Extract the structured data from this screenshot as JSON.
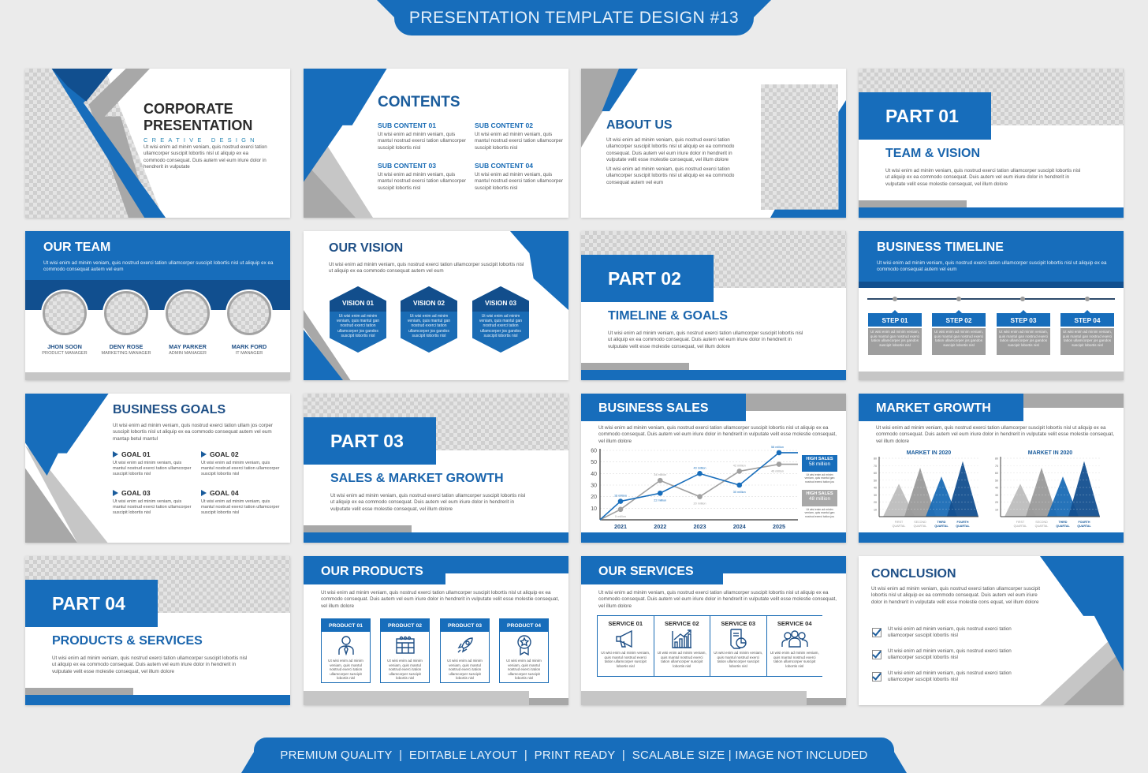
{
  "header": {
    "title": "PRESENTATION TEMPLATE DESIGN #13"
  },
  "footer": {
    "tagline": "PREMIUM QUALITY  |  EDITABLE LAYOUT  |  PRINT READY  |  SCALABLE SIZE | IMAGE NOT INCLUDED"
  },
  "theme": {
    "primary": "#176dbb",
    "dark_blue": "#114f8f",
    "gray": "#a8a8a8",
    "text": "#333333"
  },
  "slides": {
    "cover": {
      "title1": "CORPORATE",
      "title2": "PRESENTATION",
      "tagline": "CREATIVE DESIGN",
      "body": "Ut wisi enim ad minim veniam, quis nostrud exerci tation ullamcorper suscipit lobortis nisl ut aliquip ex ea commodo consequat. Duis autem vel eum iriure dolor in hendrerit in vulputate"
    },
    "contents": {
      "title": "CONTENTS",
      "items": [
        {
          "title": "SUB CONTENT 01",
          "body": "Ut wisi enim ad minim veniam, quis mantul nostrud exerci tation ullamcorper suscipit lobortis nisl"
        },
        {
          "title": "SUB CONTENT 02",
          "body": "Ut wisi enim ad minim veniam, quis mantul nostrud exerci tation ullamcorper suscipit lobortis nisl"
        },
        {
          "title": "SUB CONTENT 03",
          "body": "Ut wisi enim ad minim veniam, quis mantul nostrud exerci tation ullamcorper suscipit lobortis nisl"
        },
        {
          "title": "SUB CONTENT 04",
          "body": "Ut wisi enim ad minim veniam, quis mantul nostrud exerci tation ullamcorper suscipit lobortis nisl"
        }
      ]
    },
    "about": {
      "title": "ABOUT US",
      "body1": "Ut wisi enim ad minim veniam, quis nostrud exerci tation ullamcorper suscipit lobortis nisl ut aliquip ex ea commodo consequat. Duis autem vel eum iriure dolor in hendrerit in vulputate velit esse molestie consequat, vel illum dolore",
      "body2": "Ut wisi enim ad minim veniam, quis nostrud exerci tation ullamcorper suscipit lobortis nisl ut aliquip ex ea commodo consequat autem vel eum"
    },
    "part1": {
      "label": "PART 01",
      "subtitle": "TEAM & VISION",
      "body": "Ut wisi enim ad minim veniam, quis nostrud exerci tation ullamcorper suscipit lobortis nisl ut aliquip ex ea commodo consequat. Duis autem vel eum iriure dolor in hendrerit in vulputate velit esse molestie consequat, vel illum dolore"
    },
    "team": {
      "title": "OUR TEAM",
      "body": "Ut wisi enim ad minim veniam, quis nostrud exerci tation ullamcorper suscipit lobortis nisl ut aliquip ex ea commodo consequat autem vel eum",
      "members": [
        {
          "name": "JHON SOON",
          "role": "PRODUCT MANAGER"
        },
        {
          "name": "DENY ROSE",
          "role": "MARKETING MANAGER"
        },
        {
          "name": "MAY PARKER",
          "role": "ADMIN MANAGER"
        },
        {
          "name": "MARK FORD",
          "role": "IT MANAGER"
        }
      ]
    },
    "vision": {
      "title": "OUR VISION",
      "body": "Ut wisi enim ad minim veniam, quis nostrud exerci tation ullamcorper suscipit lobortis nisl ut aliquip ex ea commodo consequat autem vel eum",
      "items": [
        {
          "title": "VISION 01",
          "body": "Ut wisi enim ad minim veniam, quis mantul gan nostrud exerci tation ullamcorper jos gandos suscipit lobortis nisl"
        },
        {
          "title": "VISION 02",
          "body": "Ut wisi enim ad minim veniam, quis mantul gan nostrud exerci tation ullamcorper jos gandos suscipit lobortis nisl"
        },
        {
          "title": "VISION 03",
          "body": "Ut wisi enim ad minim veniam, quis mantul gan nostrud exerci tation ullamcorper jos gandos suscipit lobortis nisl"
        }
      ]
    },
    "part2": {
      "label": "PART 02",
      "subtitle": "TIMELINE & GOALS",
      "body": "Ut wisi enim ad minim veniam, quis nostrud exerci tation ullamcorper suscipit lobortis nisl ut aliquip ex ea commodo consequat. Duis autem vel eum iriure dolor in hendrerit in vulputate velit esse molestie consequat, vel illum dolore"
    },
    "timeline": {
      "title": "BUSINESS TIMELINE",
      "body": "Ut wisi enim ad minim veniam, quis nostrud exerci tation ullamcorper suscipit lobortis nisl ut aliquip ex ea commodo consequat autem vel eum",
      "steps": [
        {
          "title": "STEP 01",
          "body": "Ut wisi enim ad minim veniam, quis mantul gan nostrud exerci tation ullamcorper jos gandos suscipit lobortis nisl"
        },
        {
          "title": "STEP 02",
          "body": "Ut wisi enim ad minim veniam, quis mantul gan nostrud exerci tation ullamcorper jos gandos suscipit lobortis nisl"
        },
        {
          "title": "STEP 03",
          "body": "Ut wisi enim ad minim veniam, quis mantul gan nostrud exerci tation ullamcorper jos gandos suscipit lobortis nisl"
        },
        {
          "title": "STEP 04",
          "body": "Ut wisi enim ad minim veniam, quis mantul gan nostrud exerci tation ullamcorper jos gandos suscipit lobortis nisl"
        }
      ]
    },
    "goals": {
      "title": "BUSINESS GOALS",
      "body": "Ut wisi enim ad minim veniam, quis nostrud exerci tation ullam jos corper suscipit lobortis nisl ut aliquip ex ea commodo consequat autem vel eum mantap betul mantul",
      "items": [
        {
          "title": "GOAL 01",
          "body": "Ut wisi enim ad minim veniam, quis mantul nostrud exerci tation ullamcorper suscipit lobortis nisl"
        },
        {
          "title": "GOAL 02",
          "body": "Ut wisi enim ad minim veniam, quis mantul nostrud exerci tation ullamcorper suscipit lobortis nisl"
        },
        {
          "title": "GOAL 03",
          "body": "Ut wisi enim ad minim veniam, quis mantul nostrud exerci tation ullamcorper suscipit lobortis nisl"
        },
        {
          "title": "GOAL 04",
          "body": "Ut wisi enim ad minim veniam, quis mantul nostrud exerci tation ullamcorper suscipit lobortis nisl"
        }
      ]
    },
    "part3": {
      "label": "PART 03",
      "subtitle": "SALES & MARKET GROWTH",
      "body": "Ut wisi enim ad minim veniam, quis nostrud exerci tation ullamcorper suscipit lobortis nisl ut aliquip ex ea commodo consequat. Duis autem vel eum iriure dolor in hendrerit in vulputate velit esse molestie consequat, vel illum dolore"
    },
    "sales": {
      "title": "BUSINESS SALES",
      "body": "Ut wisi enim ad minim veniam, quis nostrud exerci tation ullamcorper suscipit lobortis nisl ut aliquip ex ea commodo consequat. Duis autem vel eum iriure dolor in hendrerit in vulputate velit esse molestie consequat, vel illum dolore",
      "legend": [
        {
          "title": "HIGH SALES",
          "value": "58 million",
          "body": "Ut wisi enim ad minim veniam, quis mantul gan nostrud exerci tation jos"
        },
        {
          "title": "HIGH SALES",
          "value": "48 million",
          "body": "Ut wisi enim ad minim veniam, quis mantul gan nostrud exerci tation jos"
        }
      ]
    },
    "market": {
      "title": "MARKET GROWTH",
      "body": "Ut wisi enim ad minim veniam, quis nostrud exerci tation ullamcorper suscipit lobortis nisl ut aliquip ex ea commodo consequat. Duis autem vel eum iriure dolor in hendrerit in vulputate velit esse molestie consequat, vel illum dolore"
    },
    "part4": {
      "label": "PART 04",
      "subtitle": "PRODUCTS & SERVICES",
      "body": "Ut wisi enim ad minim veniam, quis nostrud exerci tation ullamcorper suscipit lobortis nisl ut aliquip ex ea commodo consequat. Duis autem vel eum iriure dolor in hendrerit in vulputate velit esse molestie consequat, vel illum dolore"
    },
    "products": {
      "title": "OUR PRODUCTS",
      "body": "Ut wisi enim ad minim veniam, quis nostrud exerci tation ullamcorper suscipit lobortis nisl ut aliquip ex ea commodo consequat. Duis autem vel eum iriure dolor in hendrerit in vulputate velit esse molestie consequat, vel illum dolore",
      "items": [
        {
          "title": "PRODUCT 01",
          "icon": "businessman-icon",
          "body": "Ut wisi enim ad minim veniam, quis mantul nostrud exerci tation ullamcorper suscipit lobortis nisl"
        },
        {
          "title": "PRODUCT 02",
          "icon": "calendar-icon",
          "body": "Ut wisi enim ad minim veniam, quis mantul nostrud exerci tation ullamcorper suscipit lobortis nisl"
        },
        {
          "title": "PRODUCT 03",
          "icon": "rocket-icon",
          "body": "Ut wisi enim ad minim veniam, quis mantul nostrud exerci tation ullamcorper suscipit lobortis nisl"
        },
        {
          "title": "PRODUCT 04",
          "icon": "award-badge-icon",
          "body": "Ut wisi enim ad minim veniam, quis mantul nostrud exerci tation ullamcorper suscipit lobortis nisl"
        }
      ]
    },
    "services": {
      "title": "OUR SERVICES",
      "body": "Ut wisi enim ad minim veniam, quis nostrud exerci tation ullamcorper suscipit lobortis nisl ut aliquip ex ea commodo consequat. Duis autem vel eum iriure dolor in hendrerit in vulputate velit esse molestie consequat, vel illum dolore",
      "items": [
        {
          "title": "SERVICE 01",
          "icon": "megaphone-icon",
          "body": "Ut wisi enim ad minim veniam, quis mantul nostrud exerci tation ullamcorper suscipit lobortis nisl"
        },
        {
          "title": "SERVICE 02",
          "icon": "bar-chart-growth-icon",
          "body": "Ut wisi enim ad minim veniam, quis mantul nostrud exerci tation ullamcorper suscipit lobortis nisl"
        },
        {
          "title": "SERVICE 03",
          "icon": "report-pie-icon",
          "body": "Ut wisi enim ad minim veniam, quis mantul nostrud exerci tation ullamcorper suscipit lobortis nisl"
        },
        {
          "title": "SERVICE 04",
          "icon": "team-group-icon",
          "body": "Ut wisi enim ad minim veniam, quis mantul nostrud exerci tation ullamcorper suscipit lobortis nisl"
        }
      ]
    },
    "conclusion": {
      "title": "CONCLUSION",
      "body": "Ut wisi enim ad minim veniam, quis nostrud exerci tation ullamcorper suscipit lobortis nisl ut aliquip ex ea commodo consequat. Duis autem vel eum iriure dolor in hendrerit in vulputate velit esse molestie cons equat, vel illum dolore",
      "checks": [
        "Ut wisi enim ad minim veniam, quis nostrud exerci tation ullamcorper suscipit lobortis nisl",
        "Ut wisi enim ad minim veniam, quis nostrud exerci tation ullamcorper suscipit lobortis nisl",
        "Ut wisi enim ad minim veniam, quis nostrud exerci tation ullamcorper suscipit lobortis nisl"
      ]
    }
  },
  "chart_data": [
    {
      "type": "line",
      "title": "BUSINESS SALES",
      "categories": [
        "2021",
        "2022",
        "2023",
        "2024",
        "2025"
      ],
      "ylim": [
        0,
        60
      ],
      "yticks": [
        10,
        20,
        30,
        40,
        50,
        60
      ],
      "grid": true,
      "series": [
        {
          "name": "HIGH SALES 58 million",
          "color": "#176dbb",
          "values": [
            16,
            23,
            40,
            30,
            58
          ],
          "labels": [
            "16 million",
            "22 million",
            "40 million",
            "30 million",
            "58 million"
          ]
        },
        {
          "name": "HIGH SALES 48 million",
          "color": "#a0a0a0",
          "values": [
            9,
            34,
            20,
            42,
            48
          ],
          "labels": [
            "5 million",
            "34 million",
            "20 million",
            "42 million",
            "46 million"
          ]
        }
      ]
    },
    {
      "type": "area",
      "title": "MARKET IN 2020",
      "categories": [
        "FIRST QUARTAL",
        "SECOND QUARTAL",
        "THIRD QUARTAL",
        "FOURTH QUARTAL"
      ],
      "values": [
        45,
        67,
        55,
        76
      ],
      "colors": [
        "#bdbdbd",
        "#9a9a9a",
        "#1a6cb5",
        "#134f8f"
      ],
      "ylim": [
        0,
        80
      ],
      "yticks": [
        10,
        20,
        30,
        40,
        50,
        60,
        70,
        80
      ]
    },
    {
      "type": "area",
      "title": "MARKET IN 2020",
      "categories": [
        "FIRST QUARTAL",
        "SECOND QUARTAL",
        "THIRD QUARTAL",
        "FOURTH QUARTAL"
      ],
      "values": [
        45,
        67,
        55,
        76
      ],
      "colors": [
        "#bdbdbd",
        "#9a9a9a",
        "#1a6cb5",
        "#134f8f"
      ],
      "ylim": [
        0,
        80
      ],
      "yticks": [
        10,
        20,
        30,
        40,
        50,
        60,
        70,
        80
      ]
    }
  ]
}
